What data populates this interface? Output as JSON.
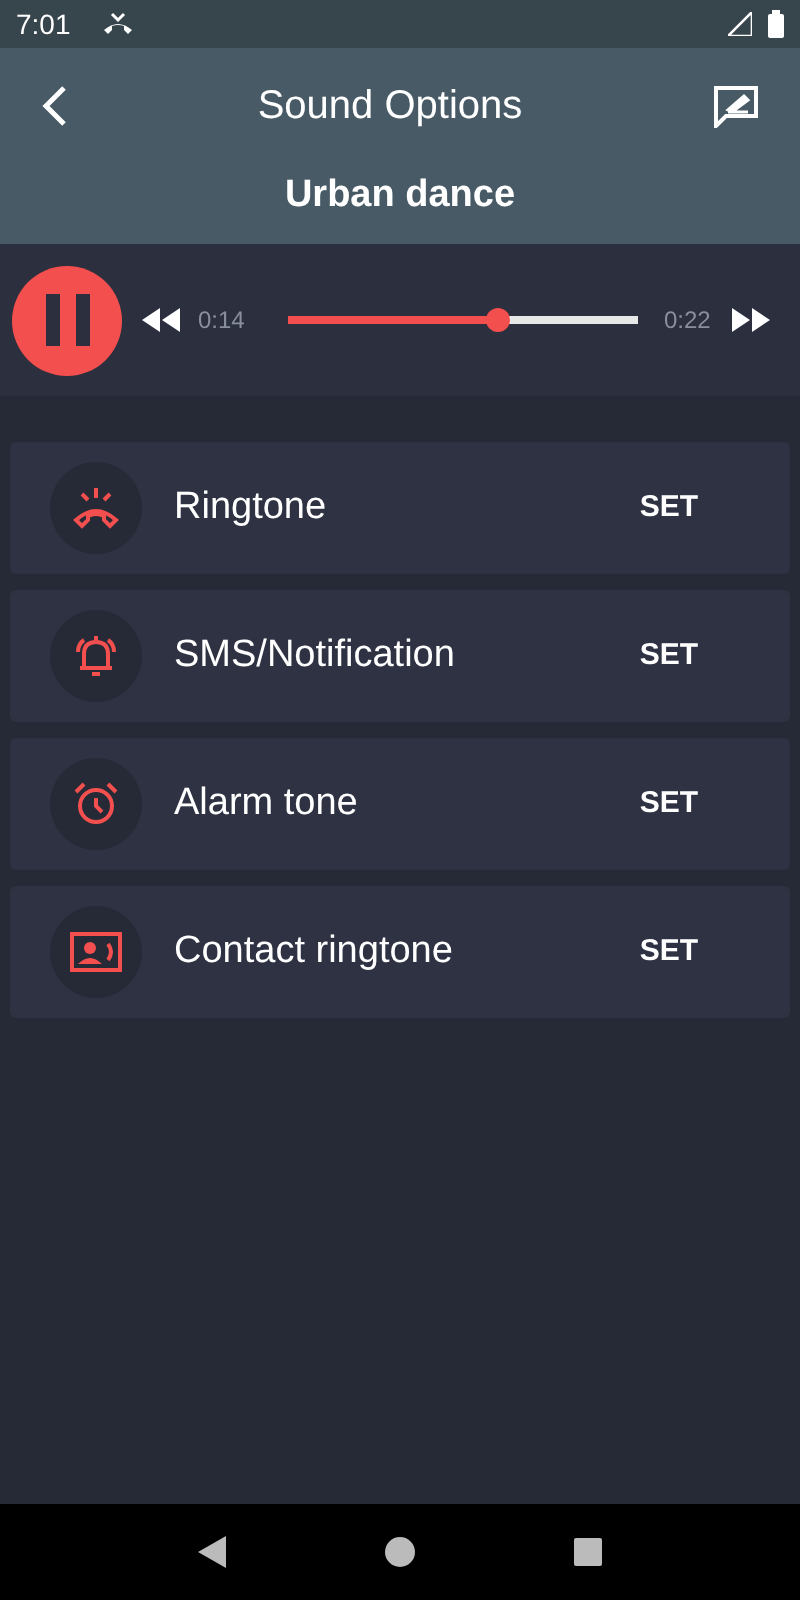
{
  "status_bar": {
    "time": "7:01"
  },
  "header": {
    "title": "Sound Options",
    "song": "Urban dance"
  },
  "player": {
    "playing": true,
    "elapsed": "0:14",
    "duration": "0:22",
    "level": 0.6
  },
  "options": [
    {
      "kind": "phone",
      "label": "Ringtone",
      "action": "SET"
    },
    {
      "kind": "bell",
      "label": "SMS/Notification",
      "action": "SET"
    },
    {
      "kind": "alarm",
      "label": "Alarm tone",
      "action": "SET"
    },
    {
      "kind": "contact",
      "label": "Contact ringtone",
      "action": "SET"
    }
  ]
}
